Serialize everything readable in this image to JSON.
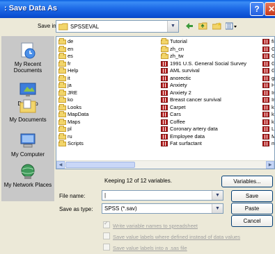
{
  "window": {
    "title": ": Save Data As"
  },
  "titlebar_buttons": {
    "help": "?",
    "close": "✕"
  },
  "save_in": {
    "label": "Save in:",
    "value": "SPSSEVAL"
  },
  "toolbar_icons": [
    "back-icon",
    "up-folder-icon",
    "new-folder-icon",
    "views-menu-icon"
  ],
  "places": [
    {
      "label": "My Recent Documents",
      "icon": "recent-documents-icon"
    },
    {
      "label": "Desktop",
      "icon": "desktop-icon"
    },
    {
      "label": "My Documents",
      "icon": "my-documents-icon"
    },
    {
      "label": "My Computer",
      "icon": "my-computer-icon"
    },
    {
      "label": "My Network Places",
      "icon": "network-places-icon"
    }
  ],
  "files": {
    "col1": [
      {
        "name": "de",
        "type": "folder"
      },
      {
        "name": "en",
        "type": "folder"
      },
      {
        "name": "es",
        "type": "folder"
      },
      {
        "name": "fr",
        "type": "folder"
      },
      {
        "name": "Help",
        "type": "folder"
      },
      {
        "name": "it",
        "type": "folder"
      },
      {
        "name": "ja",
        "type": "folder"
      },
      {
        "name": "JRE",
        "type": "folder"
      },
      {
        "name": "ko",
        "type": "folder"
      },
      {
        "name": "Looks",
        "type": "folder"
      },
      {
        "name": "MapData",
        "type": "folder"
      },
      {
        "name": "Maps",
        "type": "folder"
      },
      {
        "name": "pl",
        "type": "folder"
      },
      {
        "name": "ru",
        "type": "folder"
      },
      {
        "name": "Scripts",
        "type": "folder"
      }
    ],
    "col2": [
      {
        "name": "Tutorial",
        "type": "folder"
      },
      {
        "name": "zh_cn",
        "type": "folder"
      },
      {
        "name": "zh_tw",
        "type": "folder"
      },
      {
        "name": "1991 U.S. General Social Survey",
        "type": "data"
      },
      {
        "name": "AML survival",
        "type": "data"
      },
      {
        "name": "anorectic",
        "type": "data"
      },
      {
        "name": "Anxiety",
        "type": "data"
      },
      {
        "name": "Anxiety 2",
        "type": "data"
      },
      {
        "name": "Breast cancer survival",
        "type": "data"
      },
      {
        "name": "Carpet",
        "type": "data"
      },
      {
        "name": "Cars",
        "type": "data"
      },
      {
        "name": "Coffee",
        "type": "data"
      },
      {
        "name": "Coronary artery data",
        "type": "data"
      },
      {
        "name": "Employee data",
        "type": "data"
      },
      {
        "name": "Fat surfactant",
        "type": "data"
      }
    ],
    "col3": [
      {
        "name": "fi",
        "type": "data"
      },
      {
        "name": "G",
        "type": "data"
      },
      {
        "name": "G",
        "type": "data"
      },
      {
        "name": "G",
        "type": "data"
      },
      {
        "name": "G",
        "type": "data"
      },
      {
        "name": "gl",
        "type": "data"
      },
      {
        "name": "H",
        "type": "data"
      },
      {
        "name": "In",
        "type": "data"
      },
      {
        "name": "In",
        "type": "data"
      },
      {
        "name": "k",
        "type": "data"
      },
      {
        "name": "k",
        "type": "data"
      },
      {
        "name": "k",
        "type": "data"
      },
      {
        "name": "L",
        "type": "data"
      },
      {
        "name": "M",
        "type": "data"
      },
      {
        "name": "m",
        "type": "data"
      }
    ]
  },
  "keeping_text": "Keeping 12 of 12 variables.",
  "file_name": {
    "label": "File name:",
    "value": "|"
  },
  "save_type": {
    "label": "Save as type:",
    "value": "SPSS (*.sav)"
  },
  "buttons": {
    "variables": "Variables...",
    "save": "Save",
    "paste": "Paste",
    "cancel": "Cancel"
  },
  "options": [
    {
      "label": "Write variable names to spreadsheet",
      "checked": true
    },
    {
      "label": "Save value labels where defined instead of data values",
      "checked": false
    },
    {
      "label": "Save value labels into a .sas file",
      "checked": false
    }
  ]
}
